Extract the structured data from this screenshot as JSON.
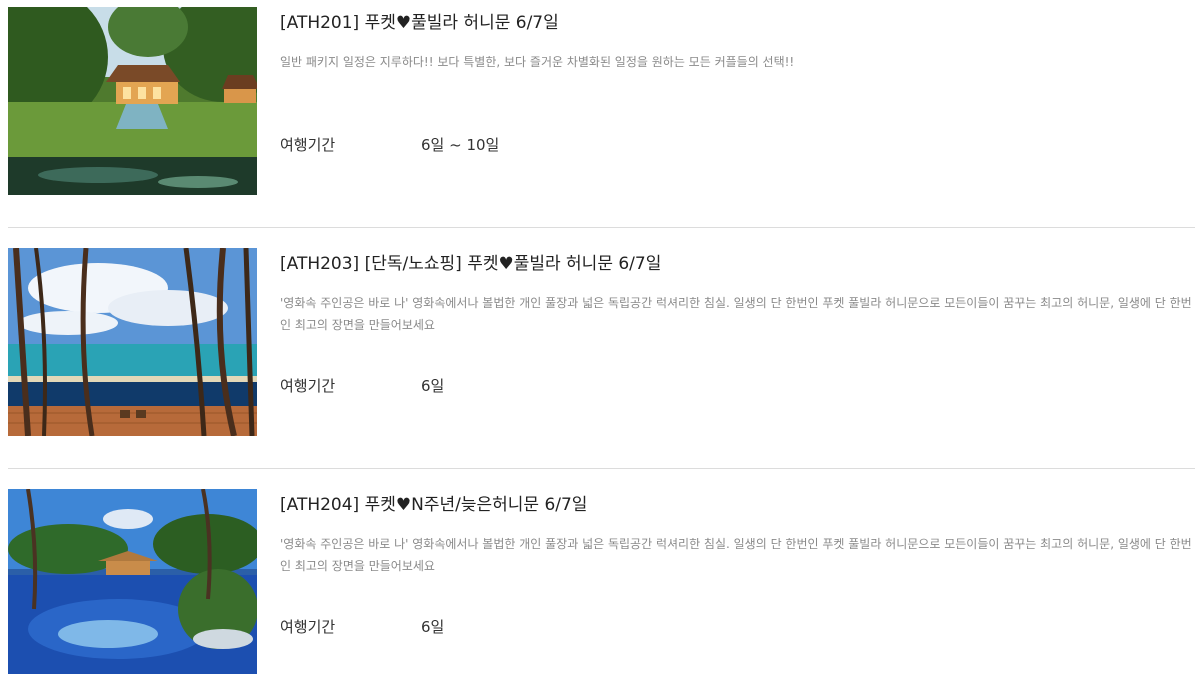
{
  "packages": [
    {
      "title": "[ATH201] 푸켓♥풀빌라 허니문 6/7일",
      "description": "일반 패키지 일정은 지루하다!! 보다 특별한, 보다 즐거운 차별화된 일정을 원하는 모든 커플들의 선택!!",
      "period_label": "여행기간",
      "period_value": "6일 ~ 10일"
    },
    {
      "title": "[ATH203] [단독/노쇼핑] 푸켓♥풀빌라 허니문 6/7일",
      "description": "'영화속 주인공은 바로 나' 영화속에서나 볼법한 개인 풀장과 넓은 독립공간 럭셔리한 침실. 일생의 단 한번인 푸켓 풀빌라 허니문으로 모든이들이 꿈꾸는 최고의 허니문, 일생에 단 한번인 최고의 장면을 만들어보세요",
      "period_label": "여행기간",
      "period_value": "6일"
    },
    {
      "title": "[ATH204] 푸켓♥N주년/늦은허니문 6/7일",
      "description": "'영화속 주인공은 바로 나' 영화속에서나 볼법한 개인 풀장과 넓은 독립공간 럭셔리한 침실. 일생의 단 한번인 푸켓 풀빌라 허니문으로 모든이들이 꿈꾸는 최고의 허니문, 일생에 단 한번인 최고의 장면을 만들어보세요",
      "period_label": "여행기간",
      "period_value": "6일"
    }
  ]
}
